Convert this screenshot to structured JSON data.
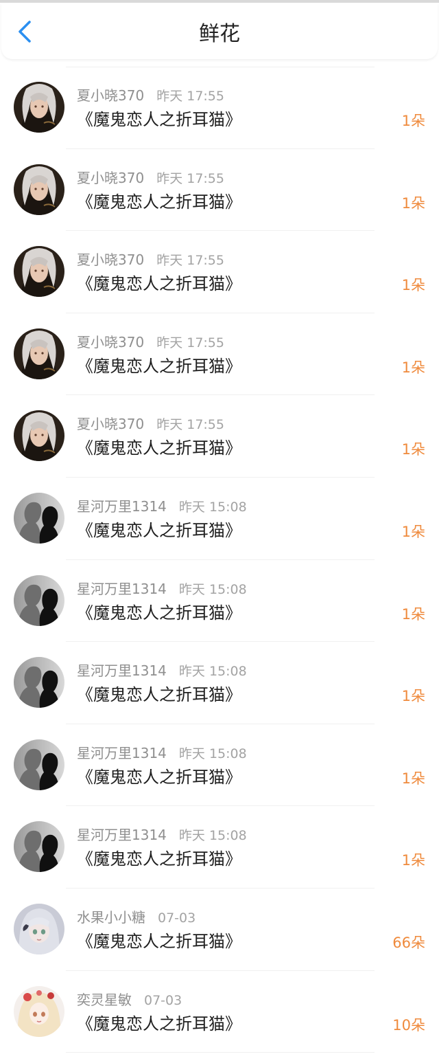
{
  "header": {
    "title": "鲜花",
    "back_icon": "chevron-left-icon",
    "accent": "#2b8ff0"
  },
  "colors": {
    "count": "#ef8a3c",
    "username": "#8f8f8f",
    "title_text": "#1f1f1f"
  },
  "rows": [
    {
      "user": "夏小晓370",
      "time": "昨天 17:55",
      "book": "《魔鬼恋人之折耳猫》",
      "count": "1朵",
      "avatar": "silver-hair-avatar"
    },
    {
      "user": "夏小晓370",
      "time": "昨天 17:55",
      "book": "《魔鬼恋人之折耳猫》",
      "count": "1朵",
      "avatar": "silver-hair-avatar"
    },
    {
      "user": "夏小晓370",
      "time": "昨天 17:55",
      "book": "《魔鬼恋人之折耳猫》",
      "count": "1朵",
      "avatar": "silver-hair-avatar"
    },
    {
      "user": "夏小晓370",
      "time": "昨天 17:55",
      "book": "《魔鬼恋人之折耳猫》",
      "count": "1朵",
      "avatar": "silver-hair-avatar"
    },
    {
      "user": "夏小晓370",
      "time": "昨天 17:55",
      "book": "《魔鬼恋人之折耳猫》",
      "count": "1朵",
      "avatar": "silver-hair-avatar"
    },
    {
      "user": "星河万里1314",
      "time": "昨天 15:08",
      "book": "《魔鬼恋人之折耳猫》",
      "count": "1朵",
      "avatar": "silhouette-avatar"
    },
    {
      "user": "星河万里1314",
      "time": "昨天 15:08",
      "book": "《魔鬼恋人之折耳猫》",
      "count": "1朵",
      "avatar": "silhouette-avatar"
    },
    {
      "user": "星河万里1314",
      "time": "昨天 15:08",
      "book": "《魔鬼恋人之折耳猫》",
      "count": "1朵",
      "avatar": "silhouette-avatar"
    },
    {
      "user": "星河万里1314",
      "time": "昨天 15:08",
      "book": "《魔鬼恋人之折耳猫》",
      "count": "1朵",
      "avatar": "silhouette-avatar"
    },
    {
      "user": "星河万里1314",
      "time": "昨天 15:08",
      "book": "《魔鬼恋人之折耳猫》",
      "count": "1朵",
      "avatar": "silhouette-avatar"
    },
    {
      "user": "水果小小糖",
      "time": "07-03",
      "book": "《魔鬼恋人之折耳猫》",
      "count": "66朵",
      "avatar": "anime-girl-avatar"
    },
    {
      "user": "奕灵星敏",
      "time": "07-03",
      "book": "《魔鬼恋人之折耳猫》",
      "count": "10朵",
      "avatar": "blonde-girl-avatar"
    }
  ]
}
